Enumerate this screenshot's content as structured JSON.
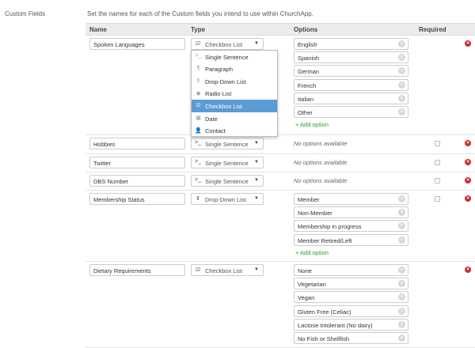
{
  "section_label": "Custom Fields",
  "intro": "Set the names for each of the Custom fields you intend to use within ChurchApp.",
  "columns": {
    "name": "Name",
    "type": "Type",
    "options": "Options",
    "required": "Required"
  },
  "add_option": "Add option",
  "no_options": "No options available",
  "dropdown": {
    "items": [
      {
        "label": "Single Sentence",
        "icon": ">_"
      },
      {
        "label": "Paragraph",
        "icon": "¶"
      },
      {
        "label": "Drop-Down List",
        "icon": "⇕"
      },
      {
        "label": "Radio List",
        "icon": "◉"
      },
      {
        "label": "Checkbox List",
        "icon": "☑",
        "selected": true
      },
      {
        "label": "Date",
        "icon": "▦"
      },
      {
        "label": "Contact",
        "icon": "👤"
      }
    ]
  },
  "rows": [
    {
      "name": "Spoken Languages",
      "type": "Checkbox List",
      "type_icon": "☑",
      "options": [
        "English",
        "Spanish",
        "German",
        "French",
        "Italian",
        "Other"
      ],
      "has_required": false
    },
    {
      "name": "Hobbies",
      "type": "Single Sentence",
      "type_icon": ">_",
      "options": [],
      "has_required": true
    },
    {
      "name": "Twitter",
      "type": "Single Sentence",
      "type_icon": ">_",
      "options": [],
      "has_required": true
    },
    {
      "name": "DBS Number",
      "type": "Single Sentence",
      "type_icon": ">_",
      "options": [],
      "has_required": true
    },
    {
      "name": "Membership Status",
      "type": "Drop-Down List",
      "type_icon": "⇕",
      "options": [
        "Member",
        "Non-Member",
        "Membership in progress",
        "Member Retired/Left"
      ],
      "has_required": true
    },
    {
      "name": "Dietary Requirements",
      "type": "Checkbox List",
      "type_icon": "☑",
      "options": [
        "None",
        "Vegetarian",
        "Vegan",
        "Gluten Free (Celiac)",
        "Lactose Intolerant (No dairy)",
        "No Fish or Shellfish"
      ],
      "has_required": false
    }
  ],
  "colors": {
    "add_option": "#2f9a2f",
    "delete": "#c9302c",
    "dropdown_selected": "#5b9bd5"
  }
}
